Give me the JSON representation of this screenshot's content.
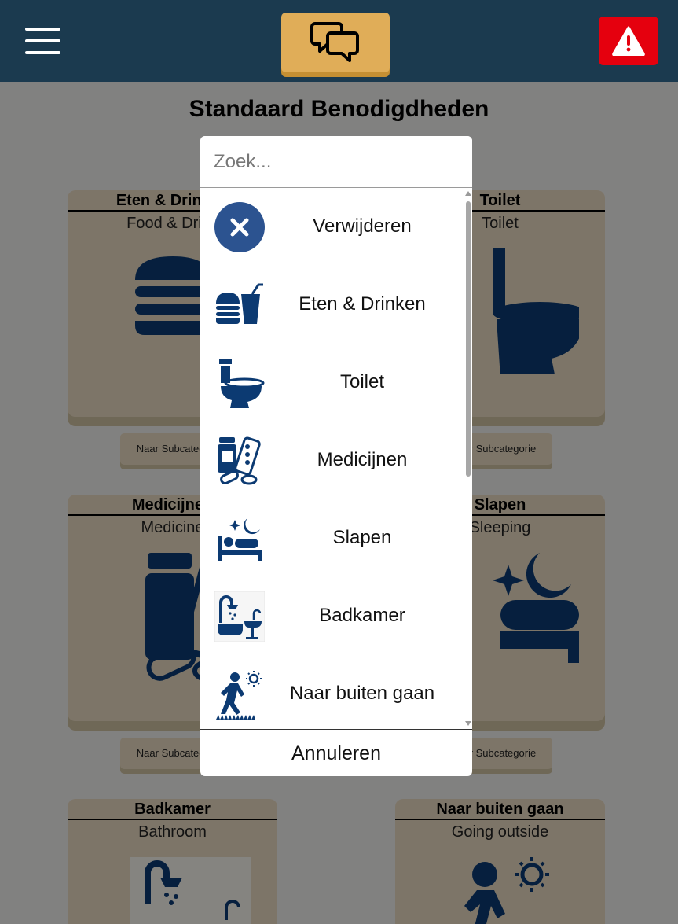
{
  "header": {
    "menu_icon": "hamburger-icon",
    "chat_icon": "chat-bubbles-icon",
    "alert_icon": "warning-icon",
    "colors": {
      "bar": "#1b3a4f",
      "chat_button": "#e0ad58",
      "alert_button": "#e5000e"
    }
  },
  "page": {
    "title": "Standaard Benodigdheden"
  },
  "cards": [
    {
      "title": "Eten & Drinken",
      "subtitle": "Food & Drink",
      "icon": "food-drink-icon"
    },
    {
      "title": "Toilet",
      "subtitle": "Toilet",
      "icon": "toilet-icon"
    },
    {
      "title": "Medicijnen",
      "subtitle": "Medicine",
      "icon": "medicine-icon"
    },
    {
      "title": "Slapen",
      "subtitle": "Sleeping",
      "icon": "sleeping-icon"
    },
    {
      "title": "Badkamer",
      "subtitle": "Bathroom",
      "icon": "bathroom-icon"
    },
    {
      "title": "Naar buiten gaan",
      "subtitle": "Going outside",
      "icon": "going-outside-icon"
    }
  ],
  "subcategory_label": "Naar Subcategorie",
  "dialog": {
    "search_placeholder": "Zoek...",
    "items": [
      {
        "label": "Verwijderen",
        "icon": "remove-icon"
      },
      {
        "label": "Eten & Drinken",
        "icon": "food-drink-icon"
      },
      {
        "label": "Toilet",
        "icon": "toilet-icon"
      },
      {
        "label": "Medicijnen",
        "icon": "medicine-icon"
      },
      {
        "label": "Slapen",
        "icon": "sleeping-icon"
      },
      {
        "label": "Badkamer",
        "icon": "bathroom-icon"
      },
      {
        "label": "Naar buiten gaan",
        "icon": "going-outside-icon"
      }
    ],
    "cancel_label": "Annuleren"
  },
  "colors": {
    "icon": "#0c3a72",
    "card": "#e4d6bd",
    "remove_circle": "#2c5390"
  }
}
